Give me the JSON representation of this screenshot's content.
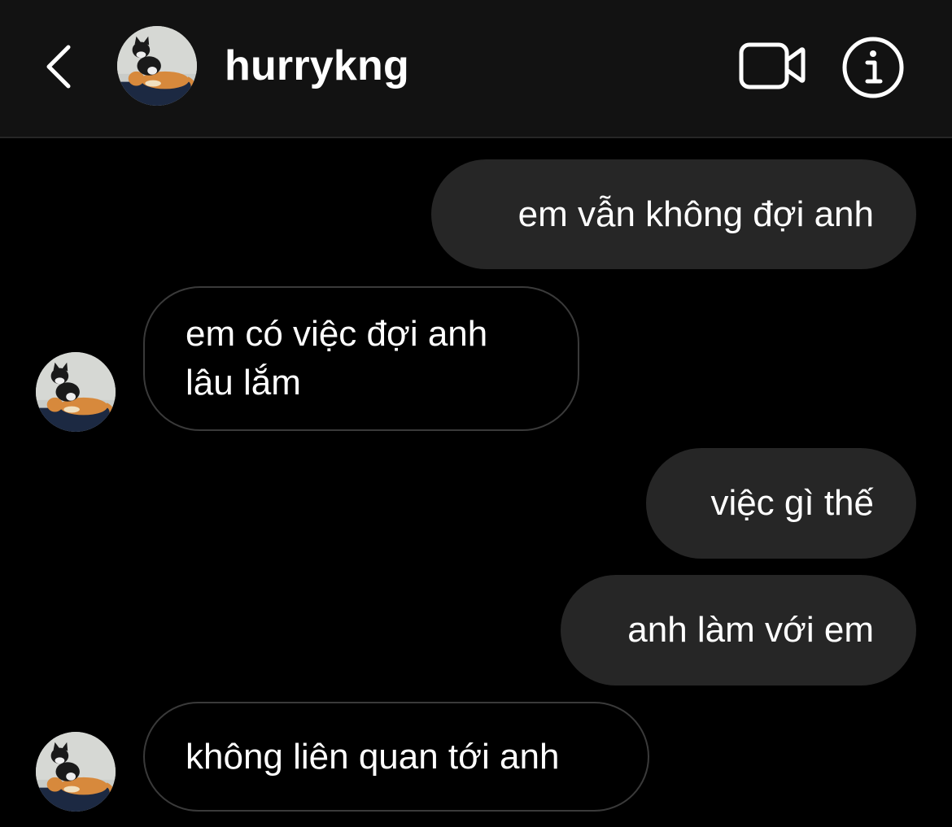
{
  "header": {
    "username": "hurrykng",
    "back_icon": "chevron-left-icon",
    "video_icon": "video-camera-icon",
    "info_icon": "info-icon"
  },
  "messages": [
    {
      "direction": "outgoing",
      "text": "em vẫn không đợi anh"
    },
    {
      "direction": "incoming",
      "text": "em có việc đợi anh\nlâu lắm"
    },
    {
      "direction": "outgoing",
      "text": "việc gì thế"
    },
    {
      "direction": "outgoing",
      "text": "anh làm với em"
    },
    {
      "direction": "incoming",
      "text": "không liên quan tới anh"
    }
  ],
  "colors": {
    "background": "#000000",
    "header_background": "#121212",
    "outgoing_bubble": "#262626",
    "incoming_border": "#3a3a3a",
    "text": "#ffffff"
  }
}
